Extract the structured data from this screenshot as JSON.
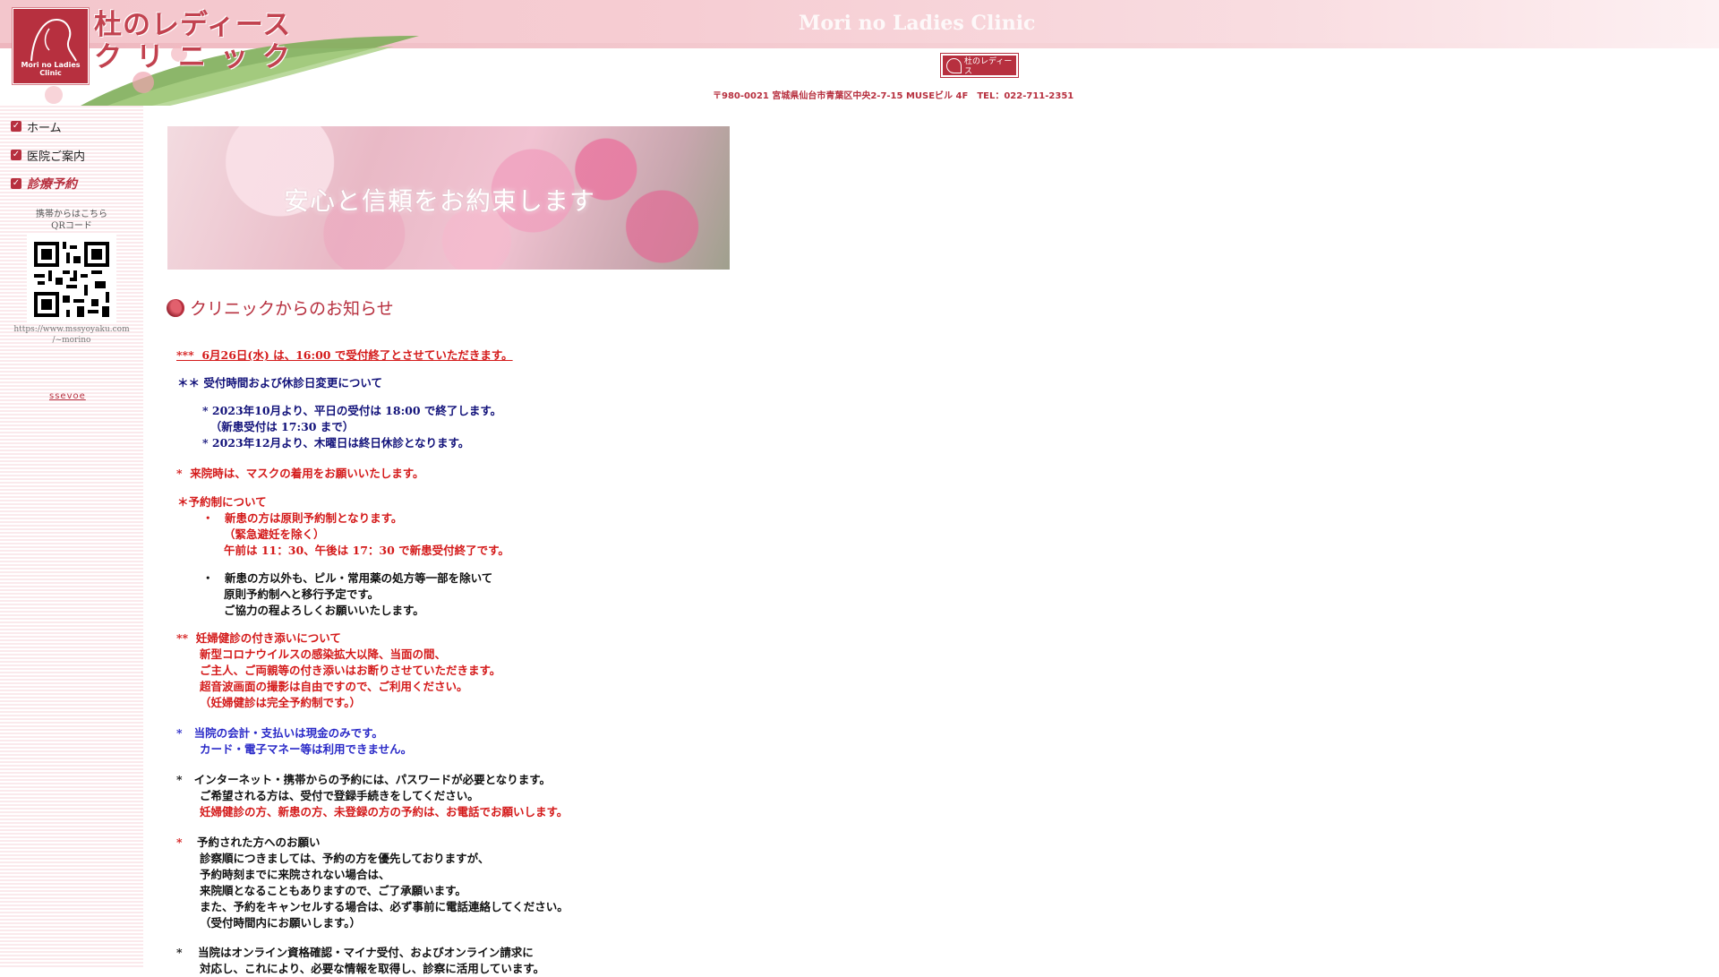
{
  "header": {
    "clinic_name_line1": "杜のレディース",
    "clinic_name_line2": "クリニック",
    "logo_text": "Mori no Ladies Clinic",
    "english_title": "Mori no Ladies Clinic",
    "mini_logo_line1": "杜のレディース",
    "mini_logo_line2": "クリニック",
    "address": "〒980-0021 宮城県仙台市青葉区中央2-7-15 MUSEビル 4F　TEL：022-711-2351",
    "brand_color": "#b7303f"
  },
  "sidebar": {
    "items": [
      {
        "label": "ホーム",
        "icon": "checkbox-icon"
      },
      {
        "label": "医院ご案内",
        "icon": "checkbox-icon"
      },
      {
        "label": "診療予約",
        "icon": "checkbox-icon"
      }
    ],
    "qr_caption_line1": "携帯からはこちら",
    "qr_caption_line2": "QRコード",
    "qr_url_line1": "https://www.mssyoyaku.com",
    "qr_url_line2": "/~morino",
    "small_link": "ssevoe"
  },
  "hero": {
    "text": "安心と信頼をお約束します"
  },
  "notice": {
    "title": "クリニックからのお知らせ",
    "lines": {
      "l01": "***  6月26日(水) は、16:00 で受付終了とさせていただきます。",
      "l02": "＊＊ 受付時間および休診日変更について",
      "l03": "* 2023年10月より、平日の受付は 18:00 で終了します。",
      "l04": "  （新患受付は 17:30 まで）",
      "l05": "* 2023年12月より、木曜日は終日休診となります。",
      "l06": "*  来院時は、マスクの着用をお願いいたします。",
      "l07": "＊予約制について",
      "l08": "・　新患の方は原則予約制となります。",
      "l09": "（緊急避妊を除く）",
      "l10": "午前は 11：30、午後は 17：30 で新患受付終了です。",
      "l11": "・　新患の方以外も、ピル・常用薬の処方等一部を除いて",
      "l12": "原則予約制へと移行予定です。",
      "l13": "ご協力の程よろしくお願いいたします。",
      "l14": "**  妊婦健診の付き添いについて",
      "l15": "新型コロナウイルスの感染拡大以降、当面の間、",
      "l16": "ご主人、ご両親等の付き添いはお断りさせていただきます。",
      "l17": "超音波画面の撮影は自由ですので、ご利用ください。",
      "l18": "（妊婦健診は完全予約制です。）",
      "l19": "*   当院の会計・支払いは現金のみです。",
      "l20": "カード・電子マネー等は利用できません。",
      "l21": "*   インターネット・携帯からの予約には、パスワードが必要となります。",
      "l22": "ご希望される方は、受付で登録手続きをしてください。",
      "l23": "妊婦健診の方、新患の方、未登録の方の予約は、お電話でお願いします。",
      "l24": "*",
      "l25": "予約された方へのお願い",
      "l26": "診察順につきましては、予約の方を優先しておりますが、",
      "l27": "予約時刻までに来院されない場合は、",
      "l28": "来院順となることもありますので、ご了承願います。",
      "l29": "また、予約をキャンセルする場合は、必ず事前に電話連絡してください。",
      "l30": "（受付時間内にお願いします。）",
      "l31": "*    当院はオンライン資格確認・マイナ受付、およびオンライン請求に",
      "l32": "対応し、これにより、必要な情報を取得し、診察に活用しています。"
    }
  }
}
